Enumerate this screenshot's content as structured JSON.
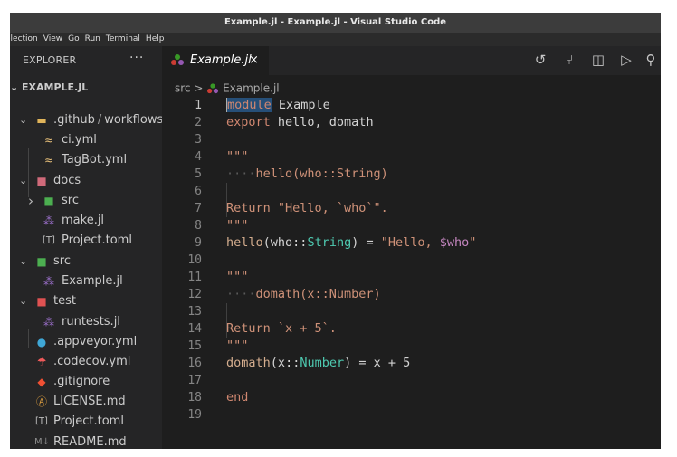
{
  "window": {
    "title": "Example.jl - Example.jl - Visual Studio Code"
  },
  "menu": [
    "election",
    "View",
    "Go",
    "Run",
    "Terminal",
    "Help"
  ],
  "sidebar": {
    "title": "EXPLORER",
    "more": "···",
    "section": "EXAMPLE.JL",
    "items": [
      {
        "label": ".github",
        "label2": "workflows",
        "sep": "/",
        "chevron": "v",
        "icon": "folder-github-icon",
        "glyph": "▬",
        "color": "#e0b45a"
      },
      {
        "label": "ci.yml",
        "icon": "yaml-icon",
        "glyph": "≈",
        "color": "#e8c07a"
      },
      {
        "label": "TagBot.yml",
        "icon": "yaml-icon",
        "glyph": "≈",
        "color": "#e8c07a"
      },
      {
        "label": "docs",
        "chevron": "v",
        "icon": "folder-docs-icon",
        "glyph": "■",
        "color": "#d06a7a"
      },
      {
        "label": "src",
        "chevron": ">",
        "icon": "folder-src-icon",
        "glyph": "■",
        "color": "#4caf50"
      },
      {
        "label": "make.jl",
        "icon": "julia-icon",
        "glyph": "⁂",
        "color": "#9a6fc9"
      },
      {
        "label": "Project.toml",
        "icon": "toml-icon",
        "glyph": "[T]",
        "color": "#bbbbbb"
      },
      {
        "label": "src",
        "chevron": "v",
        "icon": "folder-src-icon",
        "glyph": "■",
        "color": "#4caf50"
      },
      {
        "label": "Example.jl",
        "icon": "julia-icon",
        "glyph": "⁂",
        "color": "#9a6fc9"
      },
      {
        "label": "test",
        "chevron": "v",
        "icon": "folder-test-icon",
        "glyph": "■",
        "color": "#e05252"
      },
      {
        "label": "runtests.jl",
        "icon": "julia-icon",
        "glyph": "⁂",
        "color": "#9a6fc9"
      },
      {
        "label": ".appveyor.yml",
        "icon": "appveyor-icon",
        "glyph": "●",
        "color": "#3fa7d6"
      },
      {
        "label": ".codecov.yml",
        "icon": "codecov-icon",
        "glyph": "☂",
        "color": "#f05a5a"
      },
      {
        "label": ".gitignore",
        "icon": "git-icon",
        "glyph": "◆",
        "color": "#f05033"
      },
      {
        "label": "LICENSE.md",
        "icon": "license-icon",
        "glyph": "Ⓐ",
        "color": "#e0a040"
      },
      {
        "label": "Project.toml",
        "icon": "toml-icon",
        "glyph": "[T]",
        "color": "#bbbbbb"
      },
      {
        "label": "README.md",
        "icon": "markdown-icon",
        "glyph": "M↓",
        "color": "#8a8a8a"
      }
    ]
  },
  "editor": {
    "tab": {
      "label": "Example.jl",
      "close": "×"
    },
    "breadcrumb": {
      "folder": "src",
      "sep": ">",
      "file": "Example.jl"
    },
    "actions": [
      {
        "name": "timeline-icon",
        "glyph": "↺"
      },
      {
        "name": "source-control-icon",
        "glyph": "⑂"
      },
      {
        "name": "split-editor-icon",
        "glyph": "◫"
      },
      {
        "name": "run-icon",
        "glyph": "▷"
      },
      {
        "name": "more-actions-icon",
        "glyph": "⚲"
      }
    ],
    "lines": [
      {
        "n": "1",
        "tokens": [
          [
            "kw sel",
            "module"
          ],
          [
            "id",
            " Example"
          ]
        ]
      },
      {
        "n": "2",
        "tokens": [
          [
            "kw",
            "export"
          ],
          [
            "id",
            " hello, domath"
          ]
        ]
      },
      {
        "n": "3",
        "tokens": []
      },
      {
        "n": "4",
        "tokens": [
          [
            "str",
            "\"\"\""
          ]
        ]
      },
      {
        "n": "5",
        "tokens": [
          [
            "dots",
            "····"
          ],
          [
            "str",
            "hello(who::String)"
          ]
        ]
      },
      {
        "n": "6",
        "tokens": []
      },
      {
        "n": "7",
        "tokens": [
          [
            "str",
            "Return \"Hello, `who`\"."
          ]
        ]
      },
      {
        "n": "8",
        "tokens": [
          [
            "str",
            "\"\"\""
          ]
        ]
      },
      {
        "n": "9",
        "tokens": [
          [
            "fn",
            "hello"
          ],
          [
            "op",
            "("
          ],
          [
            "id",
            "who"
          ],
          [
            "op",
            "::"
          ],
          [
            "ty",
            "String"
          ],
          [
            "op",
            ") = "
          ],
          [
            "str",
            "\"Hello, "
          ],
          [
            "ip",
            "$who"
          ],
          [
            "str",
            "\""
          ]
        ]
      },
      {
        "n": "10",
        "tokens": []
      },
      {
        "n": "11",
        "tokens": [
          [
            "str",
            "\"\"\""
          ]
        ]
      },
      {
        "n": "12",
        "tokens": [
          [
            "dots",
            "····"
          ],
          [
            "str",
            "domath(x::Number)"
          ]
        ]
      },
      {
        "n": "13",
        "tokens": []
      },
      {
        "n": "14",
        "tokens": [
          [
            "str",
            "Return `x + 5`."
          ]
        ]
      },
      {
        "n": "15",
        "tokens": [
          [
            "str",
            "\"\"\""
          ]
        ]
      },
      {
        "n": "16",
        "tokens": [
          [
            "fn",
            "domath"
          ],
          [
            "op",
            "("
          ],
          [
            "id",
            "x"
          ],
          [
            "op",
            "::"
          ],
          [
            "ty",
            "Number"
          ],
          [
            "op",
            ") = x + 5"
          ]
        ]
      },
      {
        "n": "17",
        "tokens": []
      },
      {
        "n": "18",
        "tokens": [
          [
            "kw",
            "end"
          ]
        ]
      },
      {
        "n": "19",
        "tokens": []
      }
    ]
  }
}
